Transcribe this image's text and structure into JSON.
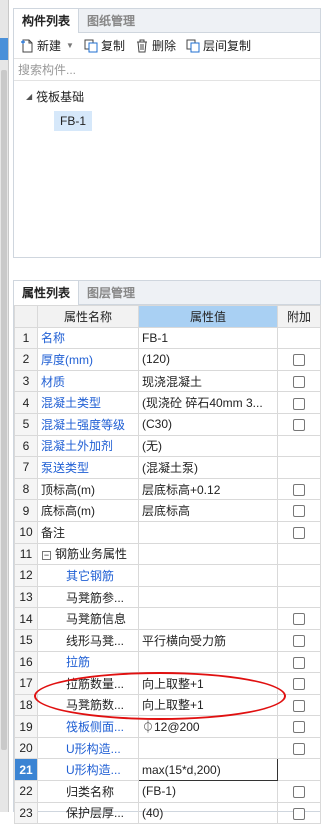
{
  "component_panel": {
    "tabs": [
      "构件列表",
      "图纸管理"
    ],
    "toolbar": {
      "new_label": "新建",
      "copy_label": "复制",
      "delete_label": "删除",
      "layer_copy_label": "层间复制"
    },
    "search_placeholder": "搜索构件...",
    "tree": {
      "root_label": "筏板基础",
      "child_label": "FB-1"
    }
  },
  "property_panel": {
    "tabs": [
      "属性列表",
      "图层管理"
    ],
    "headers": {
      "name": "属性名称",
      "value": "属性值",
      "extra": "附加"
    },
    "rows": [
      {
        "num": "1",
        "name": "名称",
        "value": "FB-1",
        "check": false
      },
      {
        "num": "2",
        "name": "厚度(mm)",
        "value": "(120)",
        "check": true
      },
      {
        "num": "3",
        "name": "材质",
        "value": "现浇混凝土",
        "check": true
      },
      {
        "num": "4",
        "name": "混凝土类型",
        "value": "(现浇砼 碎石40mm 3...",
        "check": true
      },
      {
        "num": "5",
        "name": "混凝土强度等级",
        "value": "(C30)",
        "check": true
      },
      {
        "num": "6",
        "name": "混凝土外加剂",
        "value": "(无)",
        "check": false
      },
      {
        "num": "7",
        "name": "泵送类型",
        "value": "(混凝土泵)",
        "check": false
      },
      {
        "num": "8",
        "name": "顶标高(m)",
        "value": "层底标高+0.12",
        "check": true
      },
      {
        "num": "9",
        "name": "底标高(m)",
        "value": "层底标高",
        "check": true
      },
      {
        "num": "10",
        "name": "备注",
        "value": "",
        "check": true
      },
      {
        "num": "11",
        "name": "钢筋业务属性",
        "value": "",
        "check": false
      },
      {
        "num": "12",
        "name": "其它钢筋",
        "value": "",
        "check": false
      },
      {
        "num": "13",
        "name": "马凳筋参...",
        "value": "",
        "check": false
      },
      {
        "num": "14",
        "name": "马凳筋信息",
        "value": "",
        "check": true
      },
      {
        "num": "15",
        "name": "线形马凳...",
        "value": "平行横向受力筋",
        "check": true
      },
      {
        "num": "16",
        "name": "拉筋",
        "value": "",
        "check": true
      },
      {
        "num": "17",
        "name": "拉筋数量...",
        "value": "向上取整+1",
        "check": true
      },
      {
        "num": "18",
        "name": "马凳筋数...",
        "value": "向上取整+1",
        "check": true
      },
      {
        "num": "19",
        "name": "筏板侧面...",
        "value": "⏀12@200",
        "check": true
      },
      {
        "num": "20",
        "name": "U形构造...",
        "value": "",
        "check": true
      },
      {
        "num": "21",
        "name": "U形构造...",
        "value": "max(15*d,200)",
        "check": false
      },
      {
        "num": "22",
        "name": "归类名称",
        "value": "(FB-1)",
        "check": true
      },
      {
        "num": "23",
        "name": "保护层厚...",
        "value": "(40)",
        "check": true
      }
    ]
  }
}
